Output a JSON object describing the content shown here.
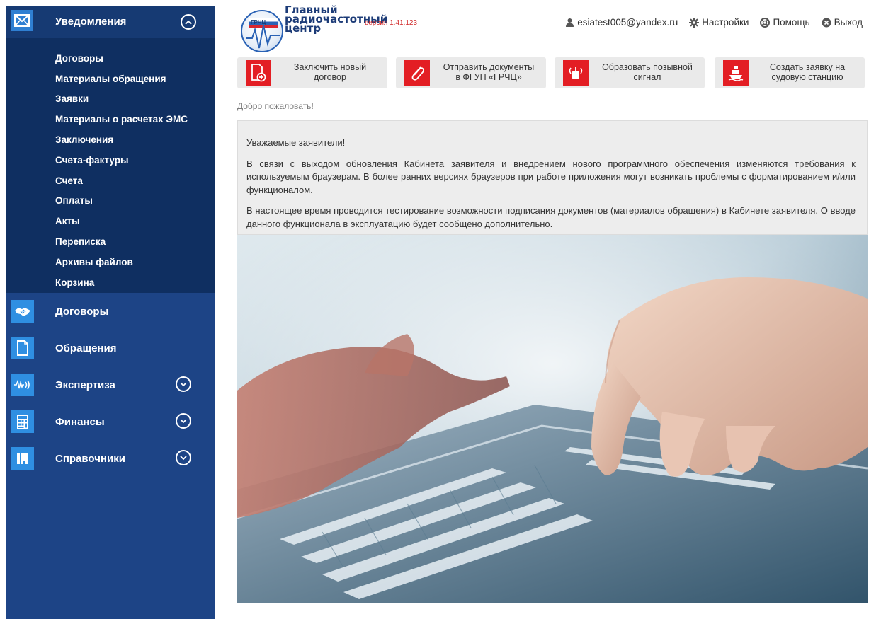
{
  "sidebar": {
    "header": {
      "title": "Уведомления",
      "icon": "envelope-icon",
      "expanded": true
    },
    "subitems": [
      "Договоры",
      "Материалы обращения",
      "Заявки",
      "Материалы о расчетах ЭМС",
      "Заключения",
      "Счета-фактуры",
      "Счета",
      "Оплаты",
      "Акты",
      "Переписка",
      "Архивы файлов",
      "Корзина"
    ],
    "items": [
      {
        "label": "Договоры",
        "icon": "handshake-icon",
        "expandable": false
      },
      {
        "label": "Обращения",
        "icon": "document-icon",
        "expandable": false
      },
      {
        "label": "Экспертиза",
        "icon": "signal-wave-icon",
        "expandable": true
      },
      {
        "label": "Финансы",
        "icon": "calculator-icon",
        "expandable": true
      },
      {
        "label": "Справочники",
        "icon": "book-icon",
        "expandable": true
      }
    ]
  },
  "header": {
    "org_line1": "Главный",
    "org_line2": "радиочастотный",
    "org_line3": "центр",
    "logo_abbr": "ГРЧЦ",
    "version": "версия 1.41.123",
    "user_email": "esiatest005@yandex.ru",
    "settings": "Настройки",
    "help": "Помощь",
    "logout": "Выход"
  },
  "actions": [
    {
      "line1": "Заключить новый",
      "line2": "договор",
      "icon": "new-document-icon"
    },
    {
      "line1": "Отправить документы",
      "line2": "в ФГУП «ГРЧЦ»",
      "icon": "paperclip-icon"
    },
    {
      "line1": "Образовать позывной",
      "line2": "сигнал",
      "icon": "radio-signal-icon"
    },
    {
      "line1": "Создать заявку на",
      "line2": "судовую станцию",
      "icon": "ship-icon"
    }
  ],
  "welcome": "Добро пожаловать!",
  "notice": {
    "greeting": "Уважаемые заявители!",
    "para1": "В связи с выходом обновления Кабинета заявителя и внедрением нового программного обеспечения изменяются требования к используемым браузерам. В более ранних версиях браузеров при работе приложения могут возникать проблемы с форматированием и/или функционалом.",
    "para2": "В настоящее время проводится тестирование возможности подписания документов (материалов обращения) в Кабинете заявителя. О вводе данного функционала в эксплуатацию будет сообщено дополнительно."
  },
  "colors": {
    "sidebar_bg": "#1d4486",
    "sidebar_sub_bg": "#0f2f61",
    "icon_blue": "#2f8fe2",
    "action_red": "#e31e24",
    "version_red": "#d12a2a"
  }
}
